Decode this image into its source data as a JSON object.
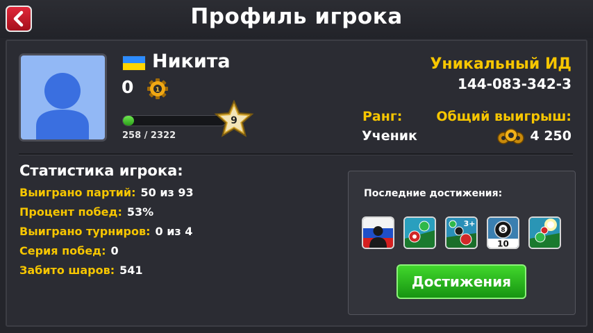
{
  "header": {
    "title": "Профиль игрока"
  },
  "colors": {
    "accent_yellow": "#f7c600",
    "button_green": "#2bb81f",
    "back_red": "#d01a2b"
  },
  "profile": {
    "name": "Никита",
    "flag": "ukraine-flag",
    "level_value": "0",
    "xp_text": "258 / 2322",
    "xp_fraction": 0.111,
    "star_level": "9",
    "unique_id_label": "Уникальный ИД",
    "unique_id": "144-083-342-3",
    "rank_label": "Ранг:",
    "rank_value": "Ученик",
    "total_win_label": "Общий выигрыш:",
    "total_win_value": "4 250"
  },
  "stats": {
    "title": "Статистика игрока:",
    "rows": [
      {
        "label": "Выиграно партий:",
        "value": "50 из 93"
      },
      {
        "label": "Процент побед:",
        "value": "53%"
      },
      {
        "label": "Выиграно турниров:",
        "value": "0 из 4"
      },
      {
        "label": "Серия побед:",
        "value": "0"
      },
      {
        "label": "Забито шаров:",
        "value": "541"
      }
    ]
  },
  "achievements": {
    "title": "Последние достижения:",
    "badges": [
      "russia-flag-badge",
      "balls-pocket-badge",
      "balls-3plus-badge",
      "eight-ball-10-badge",
      "balls-shine-badge"
    ],
    "badge_3plus_text": "3+",
    "badge_ten_text": "10",
    "badge_eight_text": "8",
    "button_label": "Достижения"
  }
}
